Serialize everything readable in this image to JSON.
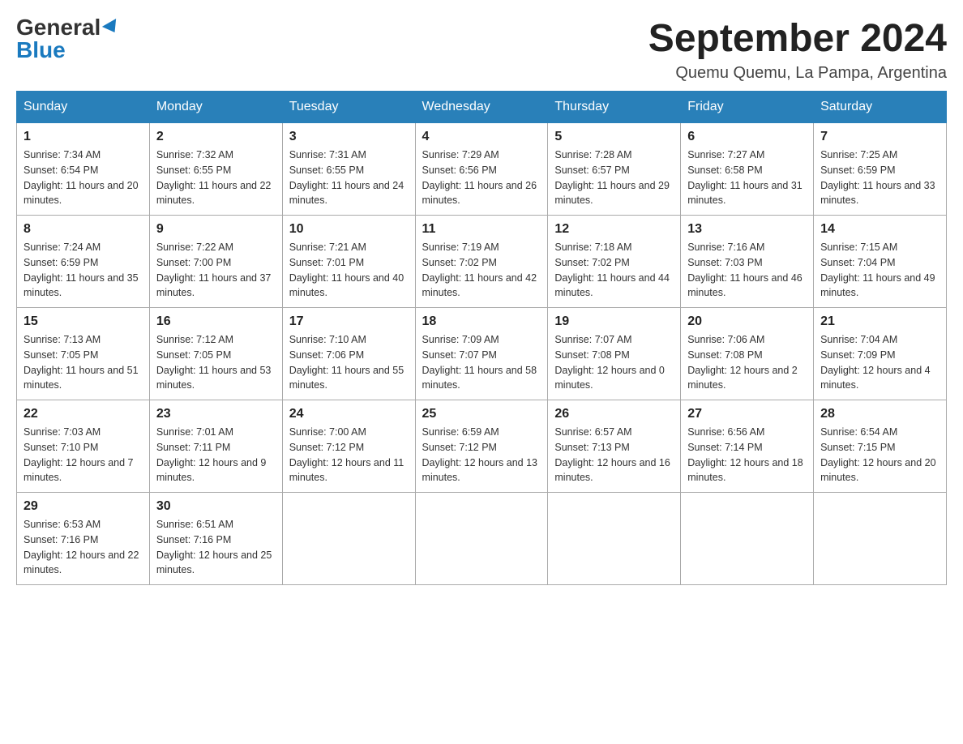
{
  "header": {
    "logo": {
      "general": "General",
      "blue": "Blue"
    },
    "title": "September 2024",
    "subtitle": "Quemu Quemu, La Pampa, Argentina"
  },
  "calendar": {
    "days_of_week": [
      "Sunday",
      "Monday",
      "Tuesday",
      "Wednesday",
      "Thursday",
      "Friday",
      "Saturday"
    ],
    "weeks": [
      [
        {
          "day": "1",
          "sunrise": "7:34 AM",
          "sunset": "6:54 PM",
          "daylight": "11 hours and 20 minutes."
        },
        {
          "day": "2",
          "sunrise": "7:32 AM",
          "sunset": "6:55 PM",
          "daylight": "11 hours and 22 minutes."
        },
        {
          "day": "3",
          "sunrise": "7:31 AM",
          "sunset": "6:55 PM",
          "daylight": "11 hours and 24 minutes."
        },
        {
          "day": "4",
          "sunrise": "7:29 AM",
          "sunset": "6:56 PM",
          "daylight": "11 hours and 26 minutes."
        },
        {
          "day": "5",
          "sunrise": "7:28 AM",
          "sunset": "6:57 PM",
          "daylight": "11 hours and 29 minutes."
        },
        {
          "day": "6",
          "sunrise": "7:27 AM",
          "sunset": "6:58 PM",
          "daylight": "11 hours and 31 minutes."
        },
        {
          "day": "7",
          "sunrise": "7:25 AM",
          "sunset": "6:59 PM",
          "daylight": "11 hours and 33 minutes."
        }
      ],
      [
        {
          "day": "8",
          "sunrise": "7:24 AM",
          "sunset": "6:59 PM",
          "daylight": "11 hours and 35 minutes."
        },
        {
          "day": "9",
          "sunrise": "7:22 AM",
          "sunset": "7:00 PM",
          "daylight": "11 hours and 37 minutes."
        },
        {
          "day": "10",
          "sunrise": "7:21 AM",
          "sunset": "7:01 PM",
          "daylight": "11 hours and 40 minutes."
        },
        {
          "day": "11",
          "sunrise": "7:19 AM",
          "sunset": "7:02 PM",
          "daylight": "11 hours and 42 minutes."
        },
        {
          "day": "12",
          "sunrise": "7:18 AM",
          "sunset": "7:02 PM",
          "daylight": "11 hours and 44 minutes."
        },
        {
          "day": "13",
          "sunrise": "7:16 AM",
          "sunset": "7:03 PM",
          "daylight": "11 hours and 46 minutes."
        },
        {
          "day": "14",
          "sunrise": "7:15 AM",
          "sunset": "7:04 PM",
          "daylight": "11 hours and 49 minutes."
        }
      ],
      [
        {
          "day": "15",
          "sunrise": "7:13 AM",
          "sunset": "7:05 PM",
          "daylight": "11 hours and 51 minutes."
        },
        {
          "day": "16",
          "sunrise": "7:12 AM",
          "sunset": "7:05 PM",
          "daylight": "11 hours and 53 minutes."
        },
        {
          "day": "17",
          "sunrise": "7:10 AM",
          "sunset": "7:06 PM",
          "daylight": "11 hours and 55 minutes."
        },
        {
          "day": "18",
          "sunrise": "7:09 AM",
          "sunset": "7:07 PM",
          "daylight": "11 hours and 58 minutes."
        },
        {
          "day": "19",
          "sunrise": "7:07 AM",
          "sunset": "7:08 PM",
          "daylight": "12 hours and 0 minutes."
        },
        {
          "day": "20",
          "sunrise": "7:06 AM",
          "sunset": "7:08 PM",
          "daylight": "12 hours and 2 minutes."
        },
        {
          "day": "21",
          "sunrise": "7:04 AM",
          "sunset": "7:09 PM",
          "daylight": "12 hours and 4 minutes."
        }
      ],
      [
        {
          "day": "22",
          "sunrise": "7:03 AM",
          "sunset": "7:10 PM",
          "daylight": "12 hours and 7 minutes."
        },
        {
          "day": "23",
          "sunrise": "7:01 AM",
          "sunset": "7:11 PM",
          "daylight": "12 hours and 9 minutes."
        },
        {
          "day": "24",
          "sunrise": "7:00 AM",
          "sunset": "7:12 PM",
          "daylight": "12 hours and 11 minutes."
        },
        {
          "day": "25",
          "sunrise": "6:59 AM",
          "sunset": "7:12 PM",
          "daylight": "12 hours and 13 minutes."
        },
        {
          "day": "26",
          "sunrise": "6:57 AM",
          "sunset": "7:13 PM",
          "daylight": "12 hours and 16 minutes."
        },
        {
          "day": "27",
          "sunrise": "6:56 AM",
          "sunset": "7:14 PM",
          "daylight": "12 hours and 18 minutes."
        },
        {
          "day": "28",
          "sunrise": "6:54 AM",
          "sunset": "7:15 PM",
          "daylight": "12 hours and 20 minutes."
        }
      ],
      [
        {
          "day": "29",
          "sunrise": "6:53 AM",
          "sunset": "7:16 PM",
          "daylight": "12 hours and 22 minutes."
        },
        {
          "day": "30",
          "sunrise": "6:51 AM",
          "sunset": "7:16 PM",
          "daylight": "12 hours and 25 minutes."
        },
        null,
        null,
        null,
        null,
        null
      ]
    ]
  }
}
